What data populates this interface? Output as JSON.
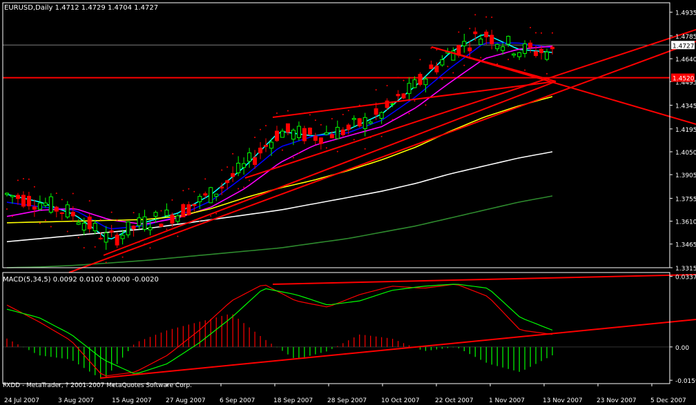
{
  "header": {
    "symbol_info": "EURUSD,Daily  1.4712 1.4729 1.4704 1.4727"
  },
  "macd_panel": {
    "label": "MACD(5,34,5) 0.0092 0.0102 0.0000 -0.0020"
  },
  "footer": {
    "copyright": "FXDD - MetaTrader, ? 2001-2007 MetaQuotes Software Corp."
  },
  "price_axis": {
    "ticks": [
      "1.4935",
      "1.4785",
      "1.4640",
      "1.4495",
      "1.4345",
      "1.4195",
      "1.4050",
      "1.3905",
      "1.3755",
      "1.3610",
      "1.3465",
      "1.3315"
    ],
    "tick_values": [
      1.4935,
      1.4785,
      1.464,
      1.4495,
      1.4345,
      1.4195,
      1.405,
      1.3905,
      1.3755,
      1.361,
      1.3465,
      1.3315
    ],
    "current_price_label": "1.4727",
    "current_price": 1.4727,
    "hline_label": "1.4520",
    "hline_price": 1.452
  },
  "macd_axis": {
    "ticks": [
      "0.0337",
      "0.00",
      "-0.0159"
    ],
    "tick_values": [
      0.0337,
      0.0,
      -0.0159
    ]
  },
  "date_axis": {
    "labels": [
      "24 Jul 2007",
      "3 Aug 2007",
      "15 Aug 2007",
      "27 Aug 2007",
      "6 Sep 2007",
      "18 Sep 2007",
      "28 Sep 2007",
      "10 Oct 2007",
      "22 Oct 2007",
      "1 Nov 2007",
      "13 Nov 2007",
      "23 Nov 2007",
      "5 Dec 2007"
    ]
  },
  "colors": {
    "background": "#000000",
    "axis": "#ffffff",
    "bull_candle": "#00ff00",
    "bear_candle": "#ff0000",
    "trendline": "#ff0000",
    "ma_cyan": "#00ffff",
    "ma_blue": "#0000ff",
    "ma_magenta": "#ff00ff",
    "ma_yellow": "#ffff00",
    "ma_white": "#ffffff",
    "ma_green": "#2e8b2e",
    "macd_main": "#ff0000",
    "macd_signal": "#00ff00",
    "current_price_line": "#808080"
  },
  "chart_data": {
    "type": "line",
    "subtype": "candlestick",
    "symbol": "EURUSD",
    "timeframe": "Daily",
    "last_bar": {
      "open": 1.4712,
      "high": 1.4729,
      "low": 1.4704,
      "close": 1.4727
    },
    "ylim": [
      1.3315,
      1.4995
    ],
    "x": [
      "24 Jul 2007",
      "3 Aug 2007",
      "15 Aug 2007",
      "27 Aug 2007",
      "6 Sep 2007",
      "18 Sep 2007",
      "28 Sep 2007",
      "10 Oct 2007",
      "22 Oct 2007",
      "1 Nov 2007",
      "13 Nov 2007",
      "23 Nov 2007",
      "5 Dec 2007"
    ],
    "series": [
      {
        "values": [
          1.378,
          1.373,
          1.365,
          1.349,
          1.36,
          1.366,
          1.378,
          1.396,
          1.418,
          1.415,
          1.419,
          1.429,
          1.447,
          1.468,
          1.48,
          1.47,
          1.468
        ]
      },
      {
        "values": [
          1.373,
          1.37,
          1.368,
          1.356,
          1.358,
          1.364,
          1.374,
          1.39,
          1.408,
          1.415,
          1.417,
          1.425,
          1.44,
          1.458,
          1.474,
          1.474,
          1.471
        ]
      },
      {
        "values": [
          1.364,
          1.368,
          1.369,
          1.362,
          1.359,
          1.363,
          1.37,
          1.382,
          1.398,
          1.409,
          1.415,
          1.421,
          1.433,
          1.449,
          1.464,
          1.47,
          1.472
        ]
      },
      {
        "values": [
          1.36,
          1.3605,
          1.361,
          1.3615,
          1.362,
          1.364,
          1.369,
          1.376,
          1.382,
          1.387,
          1.393,
          1.4,
          1.408,
          1.418,
          1.427,
          1.434,
          1.44
        ]
      },
      {
        "values": [
          1.348,
          1.35,
          1.352,
          1.354,
          1.356,
          1.359,
          1.362,
          1.365,
          1.368,
          1.372,
          1.376,
          1.38,
          1.385,
          1.391,
          1.396,
          1.401,
          1.405
        ]
      },
      {
        "values": [
          1.3315,
          1.332,
          1.333,
          1.3345,
          1.336,
          1.338,
          1.34,
          1.342,
          1.344,
          1.347,
          1.35,
          1.354,
          1.358,
          1.363,
          1.368,
          1.373,
          1.377
        ]
      }
    ],
    "macd": {
      "main": [
        0.02,
        0.012,
        0.003,
        -0.014,
        -0.012,
        -0.004,
        0.008,
        0.022,
        0.03,
        0.022,
        0.019,
        0.025,
        0.029,
        0.028,
        0.03,
        0.024,
        0.008,
        0.006
      ],
      "signal": [
        0.018,
        0.014,
        0.006,
        -0.006,
        -0.013,
        -0.008,
        0.002,
        0.014,
        0.028,
        0.025,
        0.02,
        0.022,
        0.027,
        0.029,
        0.03,
        0.028,
        0.014,
        0.008
      ]
    }
  }
}
